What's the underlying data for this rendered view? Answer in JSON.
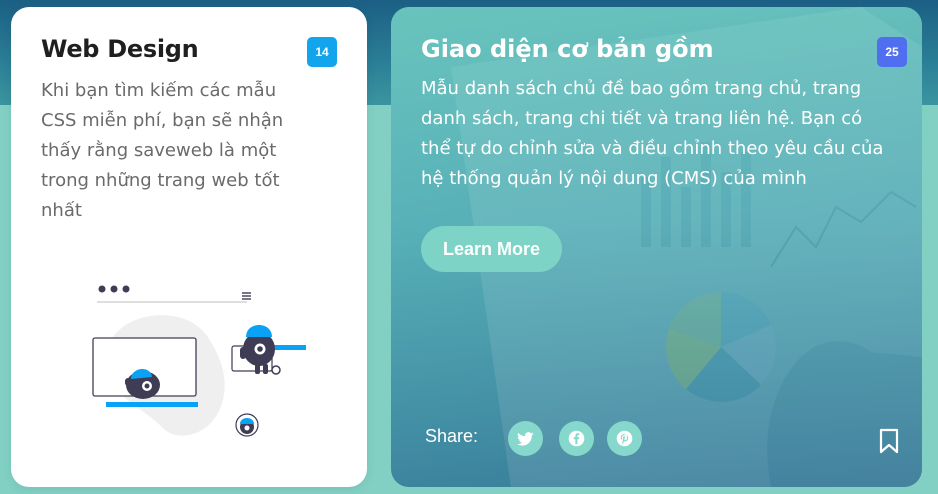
{
  "card_left": {
    "title": "Web Design",
    "badge": "14",
    "description": "Khi bạn tìm kiếm các mẫu CSS miễn phí, bạn sẽ nhận thấy rằng saveweb là một trong những trang web tốt nhất",
    "illustration": "monster-wave-illustration"
  },
  "card_right": {
    "title": "Giao diện cơ bản gồm",
    "badge": "25",
    "description": "Mẫu danh sách chủ đề bao gồm trang chủ, trang danh sách, trang chi tiết và trang liên hệ. Bạn có thể tự do chỉnh sửa và điều chỉnh theo yêu cầu của hệ thống quản lý nội dung (CMS) của mình",
    "button_label": "Learn More",
    "share_label": "Share:",
    "share_icons": [
      "twitter-icon",
      "facebook-icon",
      "pinterest-icon"
    ],
    "bookmark_icon": "bookmark-icon"
  },
  "colors": {
    "badge_left": "#12a5ec",
    "badge_right": "#4f6ef0",
    "accent": "#7ed3c7",
    "illustration_blue": "#0aa2f4"
  }
}
